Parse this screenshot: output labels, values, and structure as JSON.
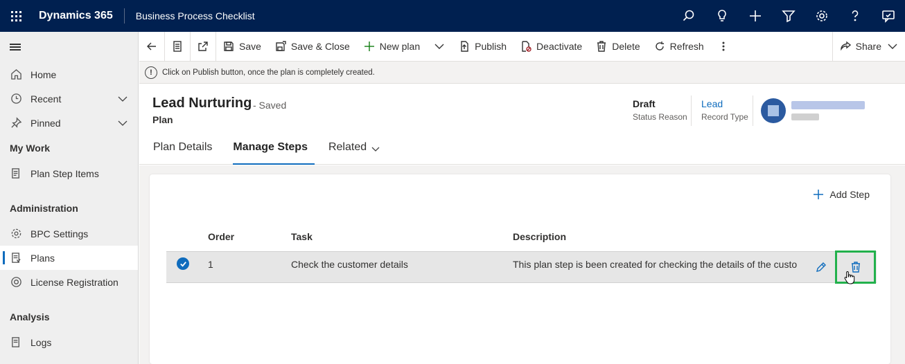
{
  "topbar": {
    "brand": "Dynamics 365",
    "app_title": "Business Process Checklist",
    "icons": [
      "search-icon",
      "lightbulb-icon",
      "plus-icon",
      "filter-icon",
      "gear-icon",
      "help-icon",
      "chat-icon"
    ]
  },
  "sidebar": {
    "items": [
      {
        "label": "Home",
        "icon": "home-icon"
      },
      {
        "label": "Recent",
        "icon": "clock-icon"
      },
      {
        "label": "Pinned",
        "icon": "pin-icon"
      }
    ],
    "groups": [
      {
        "title": "My Work",
        "items": [
          {
            "label": "Plan Step Items",
            "icon": "list-icon"
          }
        ]
      },
      {
        "title": "Administration",
        "items": [
          {
            "label": "BPC Settings",
            "icon": "gear-icon"
          },
          {
            "label": "Plans",
            "icon": "document-icon",
            "active": true
          },
          {
            "label": "License Registration",
            "icon": "badge-icon"
          }
        ]
      },
      {
        "title": "Analysis",
        "items": [
          {
            "label": "Logs",
            "icon": "report-icon"
          }
        ]
      }
    ]
  },
  "commandbar": {
    "save": "Save",
    "save_close": "Save & Close",
    "new_plan": "New plan",
    "publish": "Publish",
    "deactivate": "Deactivate",
    "delete": "Delete",
    "refresh": "Refresh",
    "share": "Share"
  },
  "notification": {
    "text": "Click on Publish button, once the plan is completely created."
  },
  "record": {
    "title": "Lead Nurturing",
    "saved_status": "- Saved",
    "entity": "Plan",
    "status_reason_value": "Draft",
    "status_reason_label": "Status Reason",
    "record_type_value": "Lead",
    "record_type_label": "Record Type"
  },
  "tabs": [
    {
      "label": "Plan Details"
    },
    {
      "label": "Manage Steps",
      "active": true
    },
    {
      "label": "Related"
    }
  ],
  "grid": {
    "add_step": "Add Step",
    "headers": {
      "order": "Order",
      "task": "Task",
      "description": "Description"
    },
    "rows": [
      {
        "order": "1",
        "task": "Check the customer details",
        "description": "This plan step is been created for checking the details of the custo"
      }
    ]
  },
  "colors": {
    "topbar": "#002050",
    "accent": "#0f6cbd",
    "highlight_box": "#22b14c"
  }
}
